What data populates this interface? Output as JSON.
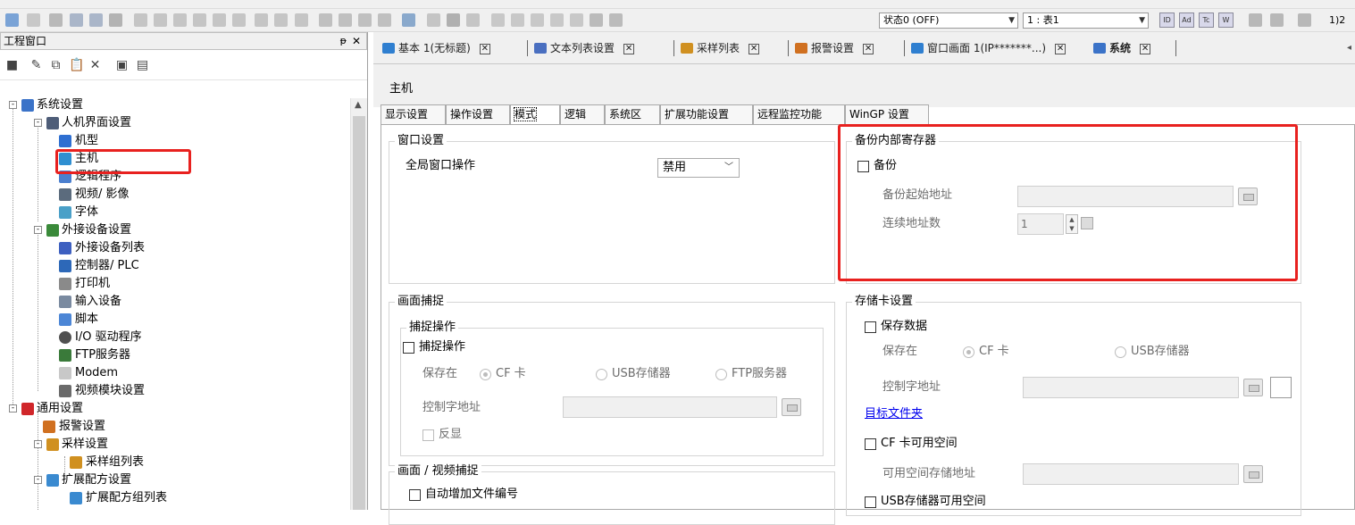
{
  "toolbar": {
    "status_select": "状态0 (OFF)",
    "screen_select": "1 : 表1",
    "mini_buttons": [
      "ID",
      "Ad",
      "Tc",
      "W"
    ],
    "partial_text": "1)2"
  },
  "left_panel": {
    "title": "工程窗口",
    "pin": "ᵽ",
    "close": "✕",
    "tree": [
      {
        "label": "系统设置",
        "level": 0,
        "expander": "-"
      },
      {
        "label": "人机界面设置",
        "level": 1,
        "expander": "-"
      },
      {
        "label": "机型",
        "level": 2
      },
      {
        "label": "主机",
        "level": 2
      },
      {
        "label": "逻辑程序",
        "level": 2
      },
      {
        "label": "视频/ 影像",
        "level": 2
      },
      {
        "label": "字体",
        "level": 2
      },
      {
        "label": "外接设备设置",
        "level": 1,
        "expander": "-"
      },
      {
        "label": "外接设备列表",
        "level": 2
      },
      {
        "label": "控制器/ PLC",
        "level": 2
      },
      {
        "label": "打印机",
        "level": 2
      },
      {
        "label": "输入设备",
        "level": 2
      },
      {
        "label": "脚本",
        "level": 2
      },
      {
        "label": "I/O 驱动程序",
        "level": 2
      },
      {
        "label": "FTP服务器",
        "level": 2
      },
      {
        "label": "Modem",
        "level": 2
      },
      {
        "label": "视频模块设置",
        "level": 2
      },
      {
        "label": "通用设置",
        "level": 0,
        "expander": "-"
      },
      {
        "label": "报警设置",
        "level": 1
      },
      {
        "label": "采样设置",
        "level": 1,
        "expander": "-"
      },
      {
        "label": "采样组列表",
        "level": 2
      },
      {
        "label": "扩展配方设置",
        "level": 1,
        "expander": "-"
      },
      {
        "label": "扩展配方组列表",
        "level": 2
      }
    ]
  },
  "doc_tabs": [
    {
      "label": "基本 1(无标题)"
    },
    {
      "label": "文本列表设置"
    },
    {
      "label": "采样列表"
    },
    {
      "label": "报警设置"
    },
    {
      "label": "窗口画面 1(IP*******...)"
    },
    {
      "label": "系统",
      "active": true
    }
  ],
  "header_title": "主机",
  "settings_tabs": [
    "显示设置",
    "操作设置",
    "模式",
    "逻辑",
    "系统区",
    "扩展功能设置",
    "远程监控功能",
    "WinGP 设置"
  ],
  "window_settings": {
    "title": "窗口设置",
    "global_label": "全局窗口操作",
    "global_value": "禁用"
  },
  "backup": {
    "title": "备份内部寄存器",
    "checkbox_label": "备份",
    "start_address_label": "备份起始地址",
    "count_label": "连续地址数",
    "count_value": "1"
  },
  "screen_capture": {
    "title": "画面捕捉",
    "sub_title": "捕捉操作",
    "checkbox_label": "捕捉操作",
    "save_label": "保存在",
    "options": [
      "CF 卡",
      "USB存储器",
      "FTP服务器"
    ],
    "control_label": "控制字地址",
    "invert_label": "反显"
  },
  "video_capture": {
    "title": "画面 / 视频捕捉",
    "auto_label": "自动增加文件编号"
  },
  "card": {
    "title": "存储卡设置",
    "save_data_label": "保存数据",
    "save_label": "保存在",
    "options": [
      "CF 卡",
      "USB存储器"
    ],
    "control_label": "控制字地址",
    "folder_link": "目标文件夹",
    "cf_free_label": "CF 卡可用空间",
    "free_addr_label": "可用空间存储地址",
    "usb_free_label": "USB存储器可用空间"
  }
}
